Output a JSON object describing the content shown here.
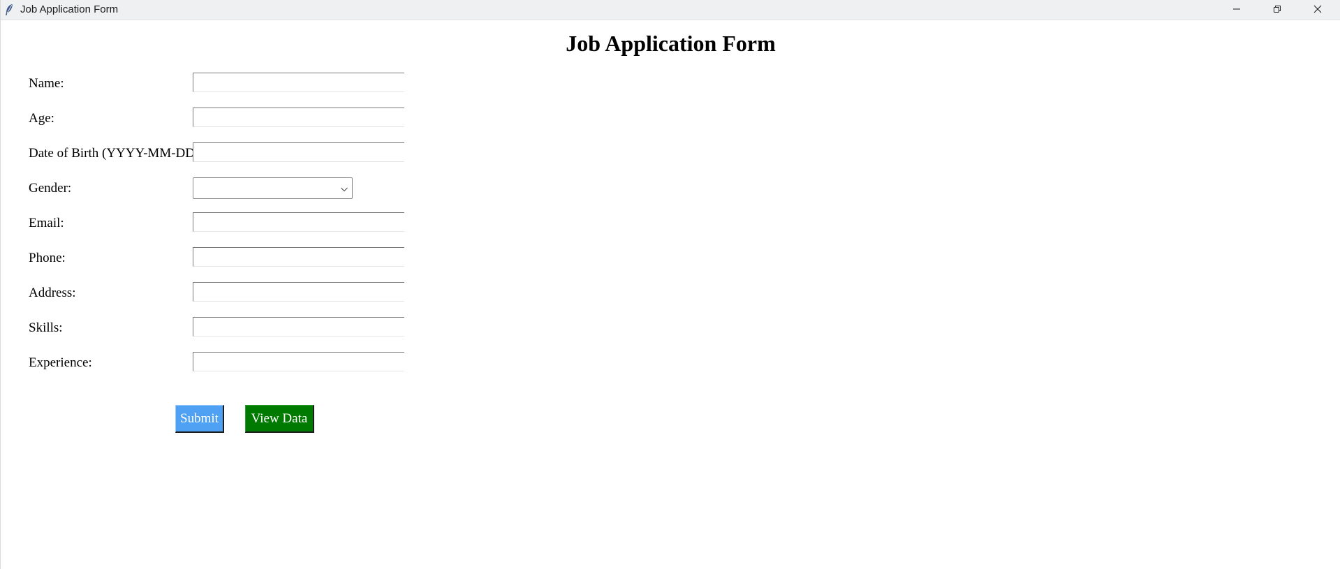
{
  "window": {
    "title": "Job Application Form",
    "controls": {
      "minimize_icon": "minimize-icon",
      "maximize_icon": "restore-icon",
      "close_icon": "close-icon"
    }
  },
  "form": {
    "heading": "Job Application Form",
    "fields": [
      {
        "label": "Name:",
        "value": ""
      },
      {
        "label": "Age:",
        "value": ""
      },
      {
        "label": "Date of Birth (YYYY-MM-DD):",
        "value": ""
      },
      {
        "label": "Gender:",
        "value": ""
      },
      {
        "label": "Email:",
        "value": ""
      },
      {
        "label": "Phone:",
        "value": ""
      },
      {
        "label": "Address:",
        "value": ""
      },
      {
        "label": "Skills:",
        "value": ""
      },
      {
        "label": "Experience:",
        "value": ""
      }
    ],
    "buttons": {
      "submit_label": "Submit",
      "view_label": "View Data"
    }
  },
  "colors": {
    "submit_bg": "#4ea1f3",
    "view_bg": "#007a00",
    "titlebar_bg": "#eff0f2"
  }
}
